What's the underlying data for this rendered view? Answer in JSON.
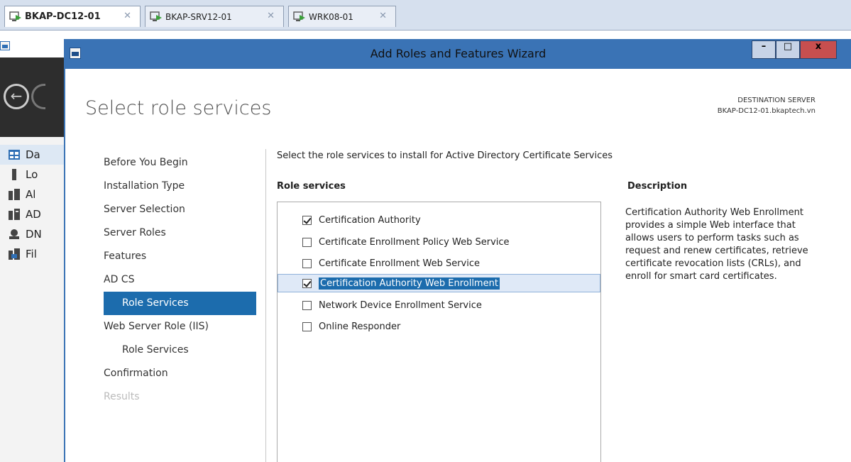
{
  "vm_tabs": [
    {
      "label": "BKAP-DC12-01",
      "active": true
    },
    {
      "label": "BKAP-SRV12-01",
      "active": false
    },
    {
      "label": "WRK08-01",
      "active": false
    }
  ],
  "server_manager": {
    "nav": [
      {
        "label": "Da",
        "icon": "dashboard-icon"
      },
      {
        "label": "Lo",
        "icon": "local-server-icon"
      },
      {
        "label": "Al",
        "icon": "all-servers-icon"
      },
      {
        "label": "AD",
        "icon": "ad-cs-icon"
      },
      {
        "label": "DN",
        "icon": "dns-icon"
      },
      {
        "label": "Fil",
        "icon": "file-services-icon"
      }
    ]
  },
  "wizard": {
    "title": "Add Roles and Features Wizard",
    "window_buttons": {
      "minimize": "–",
      "maximize": "□",
      "close": "x"
    },
    "page_title": "Select role services",
    "destination_label": "DESTINATION SERVER",
    "destination_server": "BKAP-DC12-01.bkaptech.vn",
    "steps": [
      {
        "label": "Before You Begin",
        "state": "normal"
      },
      {
        "label": "Installation Type",
        "state": "normal"
      },
      {
        "label": "Server Selection",
        "state": "normal"
      },
      {
        "label": "Server Roles",
        "state": "normal"
      },
      {
        "label": "Features",
        "state": "normal"
      },
      {
        "label": "AD CS",
        "state": "normal"
      },
      {
        "label": "Role Services",
        "state": "active"
      },
      {
        "label": "Web Server Role (IIS)",
        "state": "normal"
      },
      {
        "label": "Role Services",
        "state": "sub"
      },
      {
        "label": "Confirmation",
        "state": "normal"
      },
      {
        "label": "Results",
        "state": "disabled"
      }
    ],
    "intro": "Select the role services to install for Active Directory Certificate Services",
    "role_services_header": "Role services",
    "role_services": [
      {
        "label": "Certification Authority",
        "checked": true
      },
      {
        "label": "Certificate Enrollment Policy Web Service",
        "checked": false
      },
      {
        "label": "Certificate Enrollment Web Service",
        "checked": false
      },
      {
        "label": "Certification Authority Web Enrollment",
        "checked": true
      },
      {
        "label": "Network Device Enrollment Service",
        "checked": false
      },
      {
        "label": "Online Responder",
        "checked": false
      }
    ],
    "description_header": "Description",
    "description": "Certification Authority Web Enrollment provides a simple Web interface that allows users to perform tasks such as request and renew certificates, retrieve certificate revocation lists (CRLs), and enroll for smart card certificates."
  },
  "colors": {
    "title_bar": "#3a73b5",
    "selection": "#1c6cad",
    "close_button": "#c74f4f"
  }
}
